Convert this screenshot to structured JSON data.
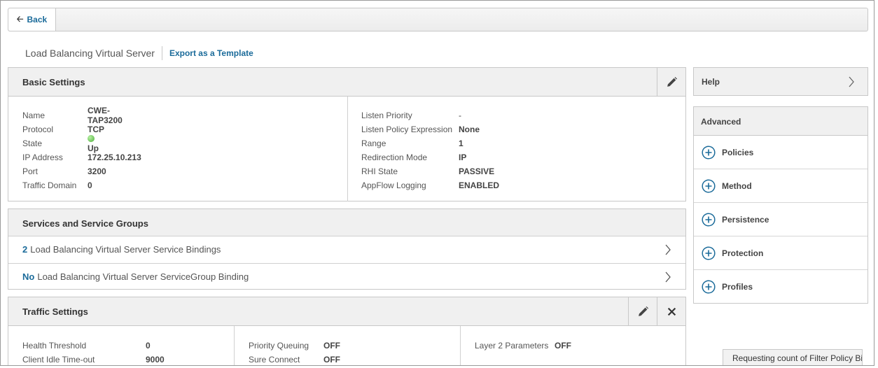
{
  "nav": {
    "back_label": "Back"
  },
  "page": {
    "title": "Load Balancing Virtual Server",
    "export_label": "Export as a Template"
  },
  "basic_settings": {
    "title": "Basic Settings",
    "left": [
      {
        "label": "Name",
        "value": "CWE-TAP3200"
      },
      {
        "label": "Protocol",
        "value": "TCP"
      },
      {
        "label": "State",
        "value": "Up"
      },
      {
        "label": "IP Address",
        "value": "172.25.10.213"
      },
      {
        "label": "Port",
        "value": "3200"
      },
      {
        "label": "Traffic Domain",
        "value": "0"
      }
    ],
    "right": [
      {
        "label": "Listen Priority",
        "value": "-"
      },
      {
        "label": "Listen Policy Expression",
        "value": "None"
      },
      {
        "label": "Range",
        "value": "1"
      },
      {
        "label": "Redirection Mode",
        "value": "IP"
      },
      {
        "label": "RHI State",
        "value": "PASSIVE"
      },
      {
        "label": "AppFlow Logging",
        "value": "ENABLED"
      }
    ],
    "state_color": "#4caf3a"
  },
  "services": {
    "title": "Services and Service Groups",
    "rows": [
      {
        "count": "2",
        "text": "Load Balancing Virtual Server Service Bindings"
      },
      {
        "count": "No",
        "text": "Load Balancing Virtual Server ServiceGroup Binding"
      }
    ]
  },
  "traffic_settings": {
    "title": "Traffic Settings",
    "col1": [
      {
        "label": "Health Threshold",
        "value": "0"
      },
      {
        "label": "Client Idle Time-out",
        "value": "9000"
      }
    ],
    "col2": [
      {
        "label": "Priority Queuing",
        "value": "OFF"
      },
      {
        "label": "Sure Connect",
        "value": "OFF"
      }
    ],
    "col3": [
      {
        "label": "Layer 2 Parameters",
        "value": "OFF"
      }
    ]
  },
  "help": {
    "label": "Help"
  },
  "advanced": {
    "title": "Advanced",
    "items": [
      {
        "label": "Policies"
      },
      {
        "label": "Method"
      },
      {
        "label": "Persistence"
      },
      {
        "label": "Protection"
      },
      {
        "label": "Profiles"
      }
    ]
  },
  "status": {
    "text": "Requesting count of Filter Policy Bi"
  },
  "colors": {
    "link": "#1b6b9a",
    "accent_plus": "#1b6b9a",
    "header_bg": "#f0f0f0"
  }
}
